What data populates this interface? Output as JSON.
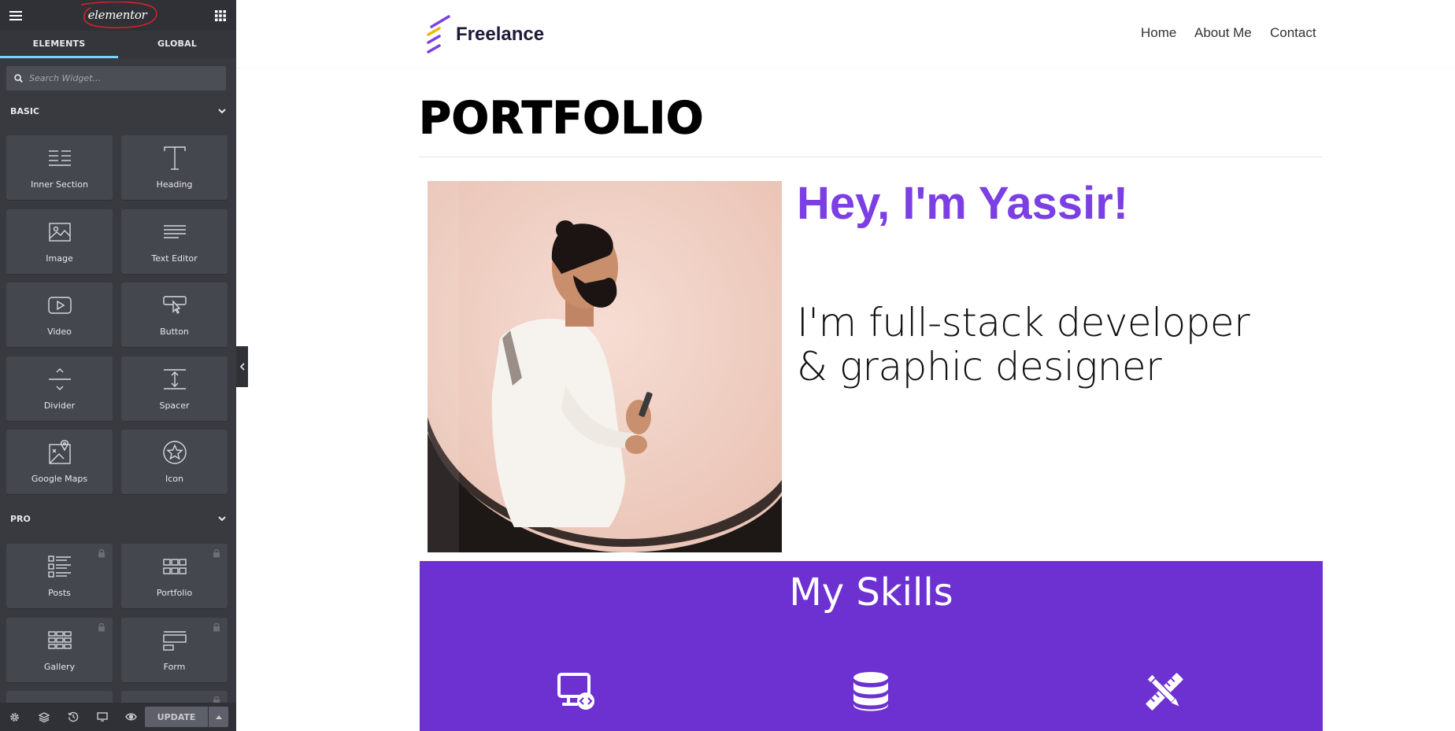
{
  "editor": {
    "logo": "elementor",
    "tabs": [
      {
        "label": "ELEMENTS",
        "active": true
      },
      {
        "label": "GLOBAL",
        "active": false
      }
    ],
    "search": {
      "placeholder": "Search Widget..."
    },
    "sections": {
      "basic": {
        "label": "BASIC",
        "widgets": [
          {
            "label": "Inner Section",
            "icon": "inner-section-icon"
          },
          {
            "label": "Heading",
            "icon": "heading-icon"
          },
          {
            "label": "Image",
            "icon": "image-icon"
          },
          {
            "label": "Text Editor",
            "icon": "text-editor-icon"
          },
          {
            "label": "Video",
            "icon": "video-icon"
          },
          {
            "label": "Button",
            "icon": "button-icon"
          },
          {
            "label": "Divider",
            "icon": "divider-icon"
          },
          {
            "label": "Spacer",
            "icon": "spacer-icon"
          },
          {
            "label": "Google Maps",
            "icon": "google-maps-icon"
          },
          {
            "label": "Icon",
            "icon": "star-icon"
          }
        ]
      },
      "pro": {
        "label": "PRO",
        "widgets": [
          {
            "label": "Posts",
            "icon": "posts-icon",
            "locked": true
          },
          {
            "label": "Portfolio",
            "icon": "portfolio-icon",
            "locked": true
          },
          {
            "label": "Gallery",
            "icon": "gallery-icon",
            "locked": true
          },
          {
            "label": "Form",
            "icon": "form-icon",
            "locked": true
          }
        ]
      }
    },
    "footer": {
      "icons": [
        "settings-icon",
        "navigator-icon",
        "history-icon",
        "responsive-icon",
        "preview-icon"
      ],
      "update_label": "UPDATE"
    },
    "accent": "#71d7f7"
  },
  "site": {
    "brand": "Freelance",
    "nav": [
      "Home",
      "About Me",
      "Contact"
    ],
    "page_title": "PORTFOLIO",
    "hero": {
      "heading": "Hey, I'm Yassir!",
      "subtitle_line1": "I'm full-stack developer",
      "subtitle_line2": "& graphic designer"
    },
    "skills": {
      "title": "My Skills",
      "icons": [
        "monitor-code-icon",
        "database-icon",
        "design-tools-icon"
      ]
    },
    "colors": {
      "purple": "#6d31d1",
      "heading_purple": "#7b3fe4"
    }
  }
}
